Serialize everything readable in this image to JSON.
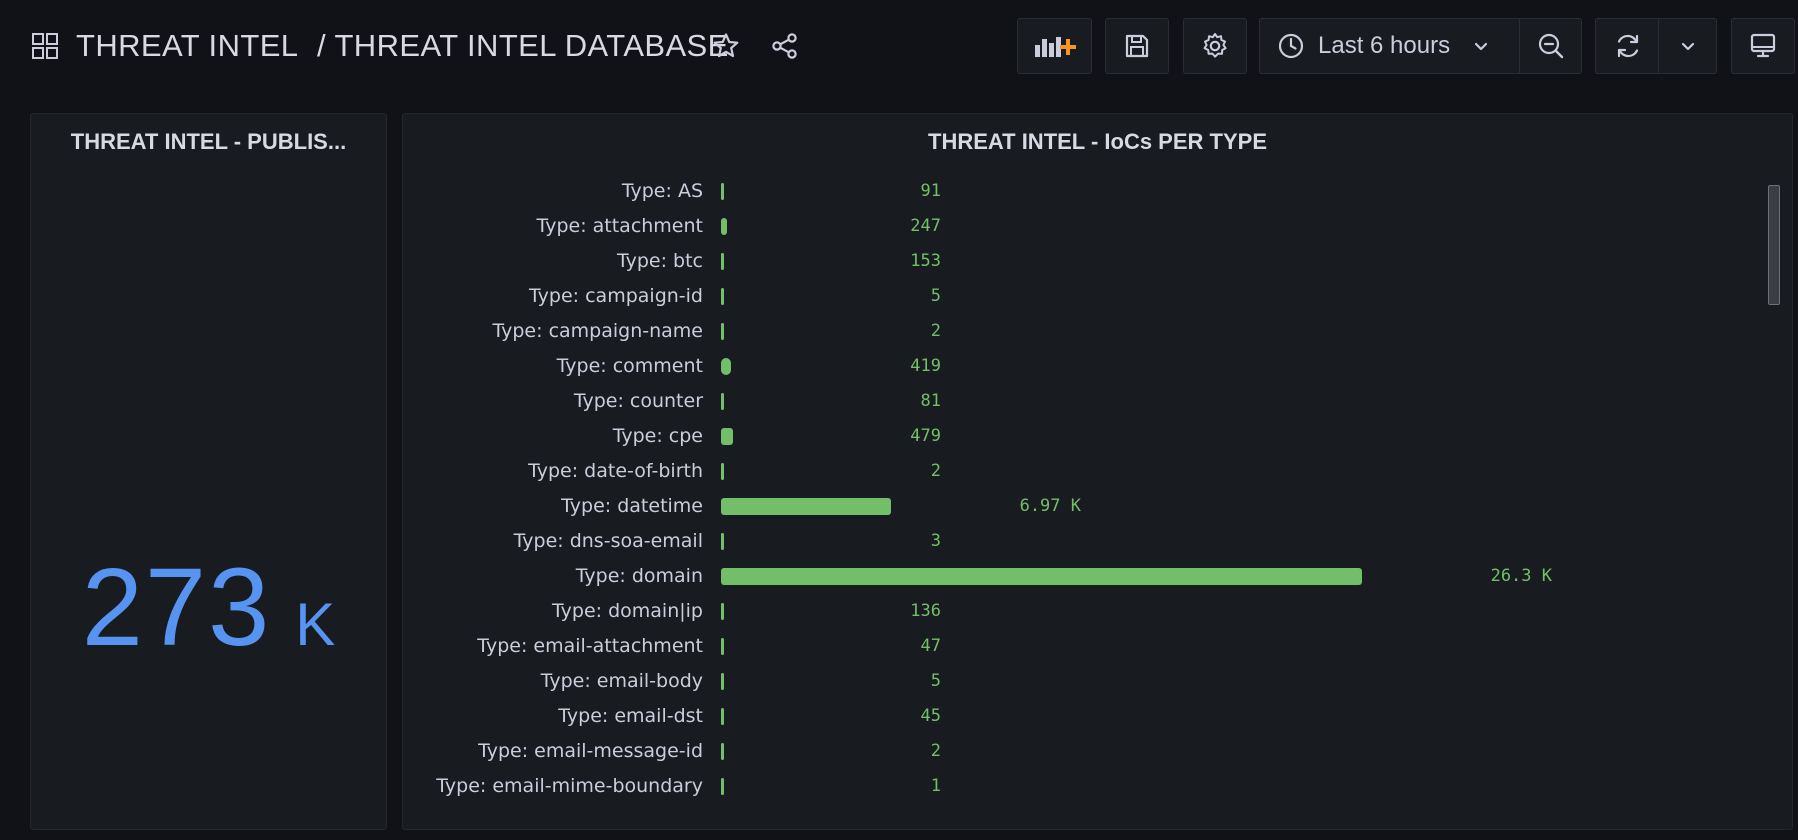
{
  "breadcrumb": {
    "folder": "THREAT INTEL",
    "dashboard": "/ THREAT INTEL DATABASE"
  },
  "toolbar": {
    "time_range": "Last 6 hours"
  },
  "colors": {
    "background": "#111217",
    "panel": "#181b1f",
    "stat_value": "#5794f2",
    "bar": "#73bf69",
    "add_accent": "#f79520"
  },
  "stat_panel": {
    "title": "THREAT INTEL - PUBLIS...",
    "value": "273",
    "unit": "K"
  },
  "bar_panel": {
    "title": "THREAT INTEL - IoCs PER TYPE",
    "chart_data": {
      "type": "bar",
      "orientation": "horizontal",
      "categories": [
        "Type: AS",
        "Type: attachment",
        "Type: btc",
        "Type: campaign-id",
        "Type: campaign-name",
        "Type: comment",
        "Type: counter",
        "Type: cpe",
        "Type: date-of-birth",
        "Type: datetime",
        "Type: dns-soa-email",
        "Type: domain",
        "Type: domain|ip",
        "Type: email-attachment",
        "Type: email-body",
        "Type: email-dst",
        "Type: email-message-id",
        "Type: email-mime-boundary"
      ],
      "values": [
        91,
        247,
        153,
        5,
        2,
        419,
        81,
        479,
        2,
        6970,
        3,
        26300,
        136,
        47,
        5,
        45,
        2,
        1
      ],
      "value_labels": [
        "91",
        "247",
        "153",
        "5",
        "2",
        "419",
        "81",
        "479",
        "2",
        "6.97 K",
        "3",
        "26.3 K",
        "136",
        "47",
        "5",
        "45",
        "2",
        "1"
      ],
      "max": 26300
    }
  }
}
